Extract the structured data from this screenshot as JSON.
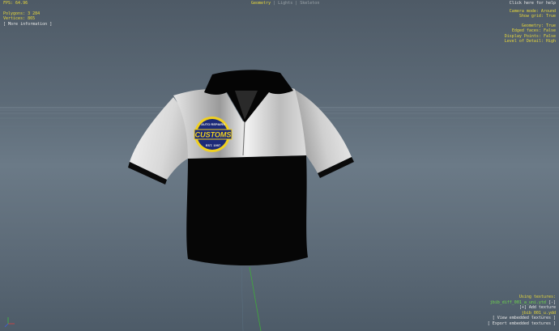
{
  "stats": {
    "fps": "FPS: 64.96",
    "polygons": "Polygons: 3 284",
    "vertices": "Vertices: 865",
    "more_info": "[ More information ]"
  },
  "tabs": {
    "geometry": "Geometry",
    "lights": "Lights",
    "skeleton": "Skeleton"
  },
  "help": {
    "click_help": "Click here for help",
    "camera_mode": "Camera mode: Around",
    "show_grid": "Show grid: True",
    "geometry": "Geometry: True",
    "edged_faces": "Edged faces: False",
    "display_points": "Display Points: False",
    "level_of_detail": "Level of Detail: High"
  },
  "textures": {
    "heading": "Using textures:",
    "ytd_file": "jbib_diff_001_a_uni.ytd",
    "ytd_remove": "[-]",
    "add_texture": "[+] Add texture",
    "ydd_file": "jbib_001_u.ydd",
    "view_embedded": "[ View embedded textures ]",
    "export_embedded": "[ Export embedded textures ]"
  },
  "badge": {
    "top_text": "AUTO REPAIRS",
    "brand": "CUSTOMS",
    "est": "EST. 1997"
  },
  "colors": {
    "overlay_yellow": "#e8d83a",
    "overlay_green": "#6fdc4a",
    "badge_navy": "#1c2a78",
    "badge_yellow": "#f0d020"
  }
}
